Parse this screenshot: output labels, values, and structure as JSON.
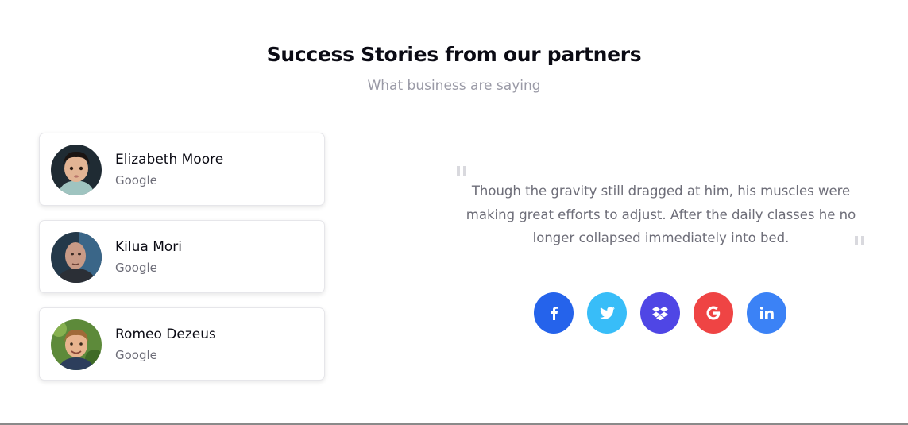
{
  "section": {
    "title": "Success Stories from our partners",
    "subtitle": "What business are saying"
  },
  "testimonials": [
    {
      "name": "Elizabeth Moore",
      "company": "Google"
    },
    {
      "name": "Kilua Mori",
      "company": "Google"
    },
    {
      "name": "Romeo Dezeus",
      "company": "Google"
    }
  ],
  "quote": {
    "text": "Though the gravity still dragged at him, his muscles were making great efforts to adjust. After the daily classes he no longer collapsed immediately into bed."
  },
  "social": [
    {
      "icon": "facebook-icon",
      "color": "#2563eb"
    },
    {
      "icon": "twitter-icon",
      "color": "#38bdf8"
    },
    {
      "icon": "dropbox-icon",
      "color": "#4f46e5"
    },
    {
      "icon": "google-icon",
      "color": "#ef4444"
    },
    {
      "icon": "linkedin-icon",
      "color": "#3b82f6"
    }
  ]
}
